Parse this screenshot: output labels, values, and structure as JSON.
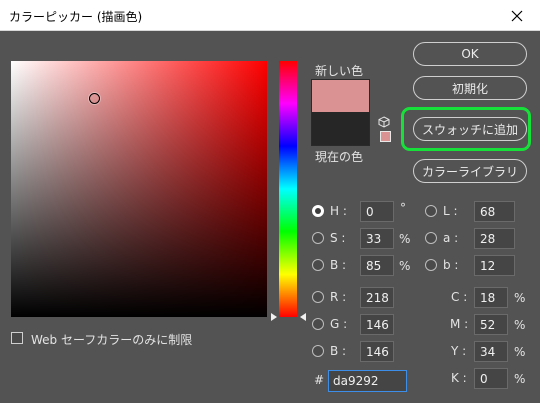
{
  "window": {
    "title": "カラーピッカー (描画色)",
    "close_icon": "close-icon"
  },
  "colors": {
    "new_color": "#da9292",
    "current_color": "#262626",
    "highlight": "#18e03a"
  },
  "swatches": {
    "new_label": "新しい色",
    "current_label": "現在の色"
  },
  "buttons": {
    "ok": "OK",
    "reset": "初期化",
    "add_to_swatches": "スウォッチに追加",
    "color_libraries": "カラーライブラリ"
  },
  "hsb": {
    "h": {
      "label": "H :",
      "value": "0",
      "unit": "°",
      "selected": true
    },
    "s": {
      "label": "S :",
      "value": "33",
      "unit": "%"
    },
    "b": {
      "label": "B :",
      "value": "85",
      "unit": "%"
    }
  },
  "rgb": {
    "r": {
      "label": "R :",
      "value": "218"
    },
    "g": {
      "label": "G :",
      "value": "146"
    },
    "b": {
      "label": "B :",
      "value": "146"
    }
  },
  "lab": {
    "l": {
      "label": "L :",
      "value": "68"
    },
    "a": {
      "label": "a :",
      "value": "28"
    },
    "b": {
      "label": "b :",
      "value": "12"
    }
  },
  "cmyk": {
    "c": {
      "label": "C :",
      "value": "18",
      "unit": "%"
    },
    "m": {
      "label": "M :",
      "value": "52",
      "unit": "%"
    },
    "y": {
      "label": "Y :",
      "value": "34",
      "unit": "%"
    },
    "k": {
      "label": "K :",
      "value": "0",
      "unit": "%"
    }
  },
  "hex": {
    "label": "#",
    "value": "da9292"
  },
  "web_safe_only": {
    "label": "Web セーフカラーのみに制限",
    "checked": false
  },
  "picker": {
    "hue_degrees": 0,
    "saturation_percent": 33,
    "brightness_percent": 85
  }
}
